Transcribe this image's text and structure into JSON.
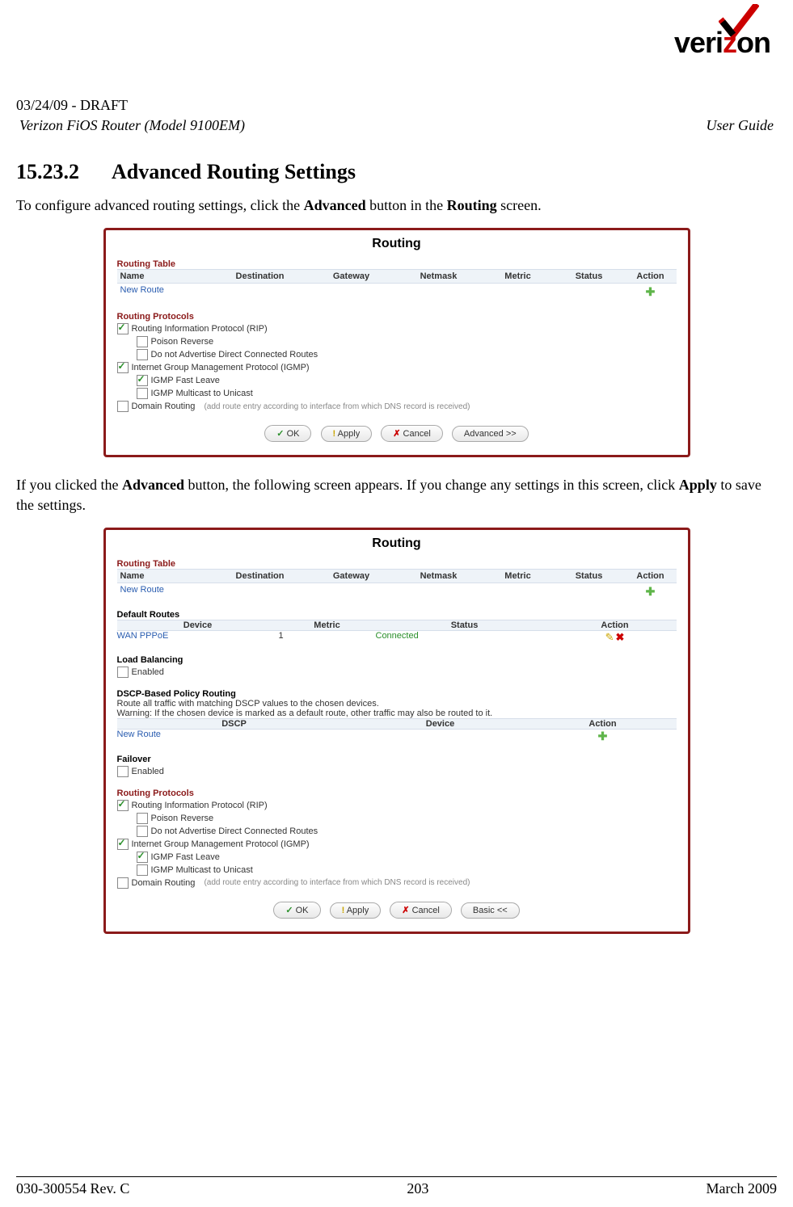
{
  "header": {
    "draft": "03/24/09 - DRAFT",
    "product": "Verizon FiOS Router (Model 9100EM)",
    "doctype": "User Guide",
    "logo_brand": "verizon",
    "logo_letter_red": "z"
  },
  "section": {
    "number": "15.23.2",
    "title": "Advanced Routing Settings"
  },
  "para1": {
    "pre": "To configure advanced routing settings, click the ",
    "b1": "Advanced",
    "mid": " button in the ",
    "b2": "Routing",
    "post": " screen."
  },
  "para2": {
    "pre": "If you clicked the ",
    "b1": "Advanced",
    "mid": " button, the following screen appears. If you change any settings in this screen, click ",
    "b2": "Apply",
    "post": " to save the settings."
  },
  "panel_common": {
    "title": "Routing",
    "routing_table_label": "Routing Table",
    "cols": {
      "name": "Name",
      "dest": "Destination",
      "gw": "Gateway",
      "nm": "Netmask",
      "met": "Metric",
      "st": "Status",
      "act": "Action"
    },
    "new_route": "New Route",
    "protocols_label": "Routing Protocols",
    "rip": "Routing Information Protocol (RIP)",
    "poison": "Poison Reverse",
    "noadv": "Do not Advertise Direct Connected Routes",
    "igmp": "Internet Group Management Protocol (IGMP)",
    "fastleave": "IGMP Fast Leave",
    "multiuni": "IGMP Multicast to Unicast",
    "domain": "Domain Routing",
    "domain_note": "(add route entry according to interface from which DNS record is received)",
    "btn_ok": "OK",
    "btn_apply": "Apply",
    "btn_cancel": "Cancel",
    "btn_adv": "Advanced >>",
    "btn_basic": "Basic <<"
  },
  "panel2": {
    "default_routes_label": "Default Routes",
    "dcols": {
      "dev": "Device",
      "met": "Metric",
      "st": "Status",
      "act": "Action"
    },
    "drow": {
      "dev": "WAN PPPoE",
      "met": "1",
      "st": "Connected"
    },
    "load_balancing_label": "Load Balancing",
    "enabled": "Enabled",
    "dscp_label": "DSCP-Based Policy Routing",
    "dscp_text": "Route all traffic with matching DSCP values to the chosen devices.",
    "dscp_warn": "Warning: If the chosen device is marked as a default route, other traffic may also be routed to it.",
    "dscp_cols": {
      "dscp": "DSCP",
      "dev": "Device",
      "act": "Action"
    },
    "failover_label": "Failover"
  },
  "footer": {
    "left": "030-300554 Rev. C",
    "center": "203",
    "right": "March 2009"
  }
}
